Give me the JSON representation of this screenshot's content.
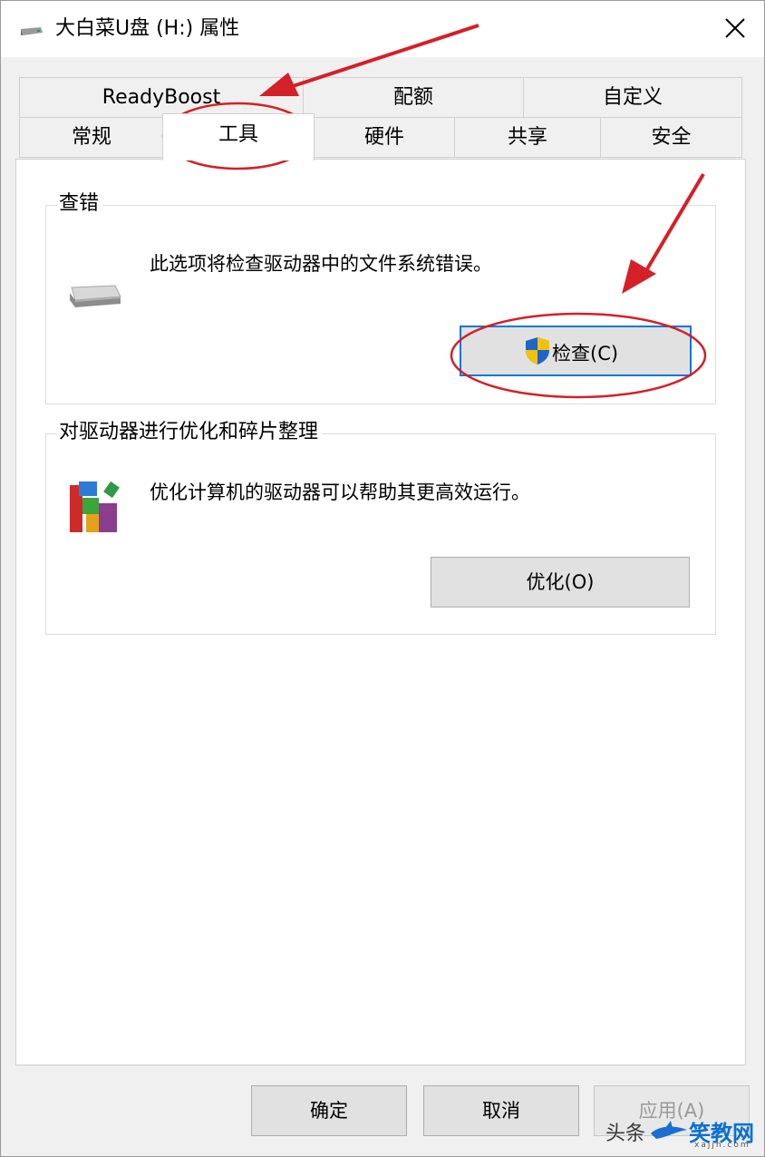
{
  "window": {
    "title": "大白菜U盘 (H:) 属性",
    "close_glyph": "close-icon"
  },
  "tabs": {
    "row1": [
      {
        "label": "ReadyBoost"
      },
      {
        "label": "配额"
      },
      {
        "label": "自定义"
      }
    ],
    "row2": [
      {
        "label": "常规"
      },
      {
        "label": "工具"
      },
      {
        "label": "硬件"
      },
      {
        "label": "共享"
      },
      {
        "label": "安全"
      }
    ],
    "active": "工具"
  },
  "error_check": {
    "group_label": "查错",
    "description": "此选项将检查驱动器中的文件系统错误。",
    "button_label": "检查(C)",
    "icon": "drive-icon",
    "button_icon": "uac-shield-icon"
  },
  "optimize": {
    "group_label": "对驱动器进行优化和碎片整理",
    "description": "优化计算机的驱动器可以帮助其更高效运行。",
    "button_label": "优化(O)",
    "icon": "defrag-icon"
  },
  "footer": {
    "ok_label": "确定",
    "cancel_label": "取消",
    "apply_label": "应用(A)"
  },
  "watermark": {
    "left_text": "头条",
    "brand_text": "笑教网",
    "url_text": "xajjn.com"
  },
  "colors": {
    "accent": "#0078d7",
    "annotation": "#d42027",
    "panel_bg": "#ffffff",
    "window_bg": "#f0f0f0"
  }
}
